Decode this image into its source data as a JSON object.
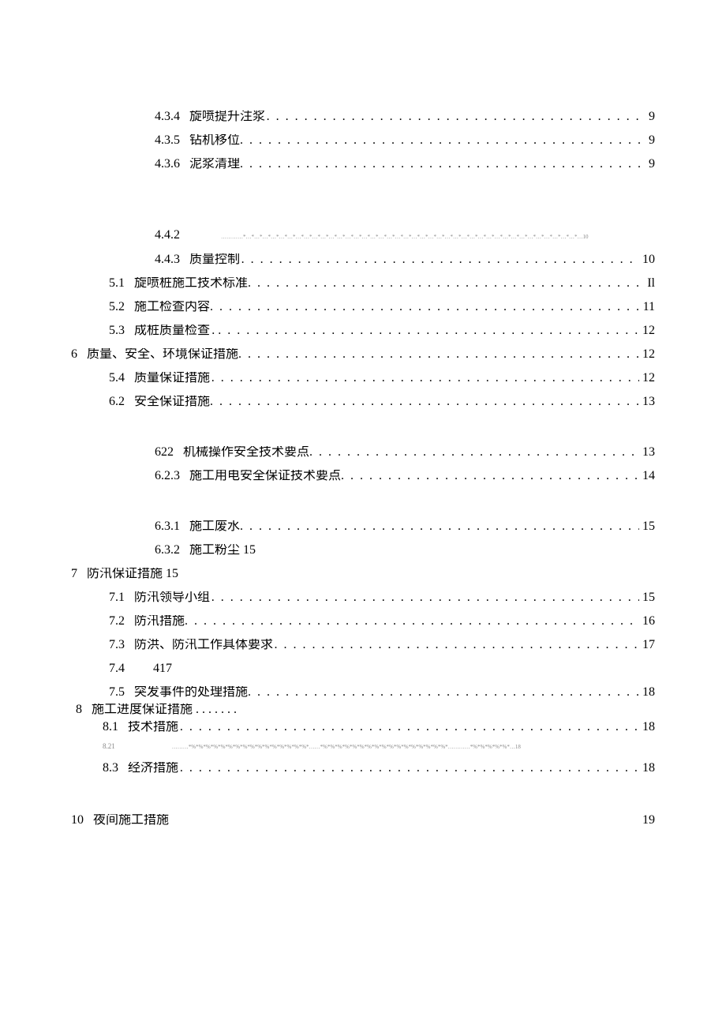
{
  "entries": {
    "e434": {
      "num": "4.3.4",
      "title": "旋喷提升注浆",
      "page": "9"
    },
    "e435": {
      "num": "4.3.5",
      "title": "钻机移位",
      "page": "9"
    },
    "e436": {
      "num": "4.3.6",
      "title": "泥浆清理",
      "page": "9"
    },
    "e442": {
      "num": "4.4.2",
      "title": "",
      "page": "10",
      "noise": "…………*…*…*…*…*…*…*…*…*…*…*…*…*…*…*…*…*…*…*…*…*…*…*…*…*…*…*…*…*…*…*…*…*…*…*…*…*…*…*…*…*…10"
    },
    "e443": {
      "num": "4.4.3",
      "title": "质量控制",
      "page": "10"
    },
    "e51": {
      "num": "5.1",
      "title": "旋喷桩施工技术标准",
      "page": "Il"
    },
    "e52": {
      "num": "5.2",
      "title": "施工检查内容",
      "page": "11"
    },
    "e53": {
      "num": "5.3",
      "title": "成桩质量检查",
      "page": "12"
    },
    "e6": {
      "num": "6",
      "title": "质量、安全、环境保证措施",
      "page": "12"
    },
    "e54": {
      "num": "5.4",
      "title": "质量保证措施",
      "page": "12"
    },
    "e62": {
      "num": "6.2",
      "title": "安全保证措施",
      "page": "13"
    },
    "e622": {
      "num": "622",
      "title": "机械操作安全技术要点",
      "page": "13"
    },
    "e623": {
      "num": "6.2.3",
      "title": "施工用电安全保证技术要点",
      "page": "14"
    },
    "e631": {
      "num": "6.3.1",
      "title": "施工废水",
      "page": "15"
    },
    "e632": {
      "num": "6.3.2",
      "title": "施工粉尘 15",
      "page": ""
    },
    "e7": {
      "num": "7",
      "title": "防汛保证措施 15",
      "page": ""
    },
    "e71": {
      "num": "7.1",
      "title": "防汛领导小组",
      "page": "15"
    },
    "e72": {
      "num": "7.2",
      "title": "防汛措施",
      "page": "16"
    },
    "e73": {
      "num": "7.3",
      "title": "防洪、防汛工作具体要求",
      "page": "17"
    },
    "e74": {
      "num": "7.4",
      "title": "417",
      "page": ""
    },
    "e75": {
      "num": "7.5",
      "title": "突发事件的处理措施",
      "page": "18"
    },
    "e8": {
      "num": "8",
      "title": "施工进度保证措施 . . . . . . .",
      "page": ""
    },
    "e81": {
      "num": "8.1",
      "title": "技术措施",
      "page": "18"
    },
    "e821": {
      "num": "8.21",
      "title": "",
      "page": "18",
      "noise": "………*%*%*%*%*%*%*%*%*%*%*%*%*%*%*%*%*……*%*%*%*%*%*%*%*%*%*%*%*%*%*%*%*%*%*…………*%*%*%*%*%*…18"
    },
    "e83": {
      "num": "8.3",
      "title": "经济措施",
      "page": "18"
    },
    "e10": {
      "num": "10",
      "title": "夜间施工措施",
      "page": "19"
    }
  }
}
